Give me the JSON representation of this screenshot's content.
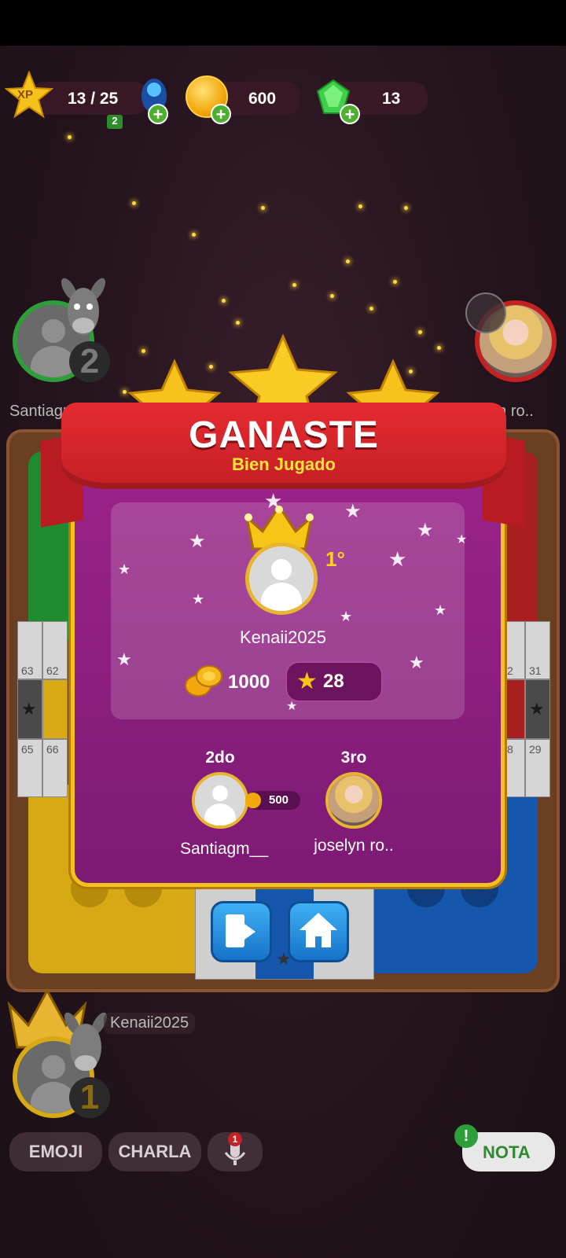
{
  "hud": {
    "xp_label": "XP",
    "xp_progress": "13 / 25",
    "level_badge": "2",
    "coins": "600",
    "gems": "13"
  },
  "players_top": {
    "left": {
      "name": "Santiagm__",
      "seat_number": "2"
    },
    "right": {
      "name": "joselyn ro.."
    }
  },
  "board": {
    "left_cells_top": [
      "63",
      "62"
    ],
    "left_cells_bottom": [
      "65",
      "66"
    ],
    "right_cells_top": [
      "2",
      "31"
    ],
    "right_cells_bottom": [
      "8",
      "29"
    ]
  },
  "result": {
    "title": "GANASTE",
    "subtitle": "Bien Jugado",
    "first": {
      "place": "1°",
      "name": "Kenaii2025",
      "coins": "1000",
      "stars": "28"
    },
    "second": {
      "place": "2do",
      "name": "Santiagm__",
      "coins": "500"
    },
    "third": {
      "place": "3ro",
      "name": "joselyn ro.."
    }
  },
  "bottom_player": {
    "name": "Kenaii2025",
    "seat_number": "1"
  },
  "actions": {
    "emoji": "EMOJI",
    "chat": "CHARLA",
    "note": "NOTA",
    "note_alert": "!",
    "mic_badge": "1"
  },
  "colors": {
    "panel": "#8a1c7c",
    "ribbon": "#d8232a",
    "gold": "#f5c518",
    "blue_button": "#1e8fe0",
    "green": "#2e9e3a",
    "yellow": "#e2b619",
    "blue": "#1660b8",
    "red": "#c42222"
  }
}
